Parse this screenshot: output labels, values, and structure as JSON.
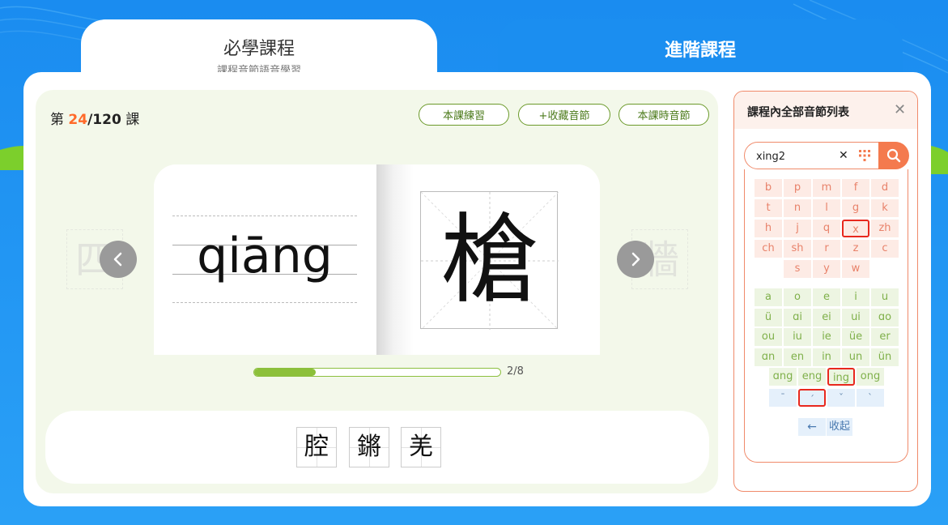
{
  "tabs": {
    "active": {
      "title": "必學課程",
      "subtitle": "課程音節語音學習"
    },
    "inactive": {
      "title": "進階課程"
    }
  },
  "lesson": {
    "prefix": "第 ",
    "current": "24",
    "separator": "/",
    "total": "120",
    "suffix": " 課",
    "buttons": {
      "practice": "本課練習",
      "favorite": "+收藏音節",
      "syllables": "本課時音節"
    }
  },
  "flashcard": {
    "pinyin": "qiāng",
    "character": "槍",
    "prev_ghost": "四",
    "next_ghost": "牆"
  },
  "progress": {
    "fraction": 0.25,
    "label": "2/8"
  },
  "related": [
    "腔",
    "鏘",
    "羌"
  ],
  "side_panel": {
    "title": "課程內全部音節列表",
    "search_value": "xing2",
    "initials": [
      [
        "b",
        "p",
        "m",
        "f",
        "d"
      ],
      [
        "t",
        "n",
        "l",
        "g",
        "k"
      ],
      [
        "h",
        "j",
        "q",
        "x",
        "zh"
      ],
      [
        "ch",
        "sh",
        "r",
        "z",
        "c"
      ],
      [
        "s",
        "y",
        "w"
      ]
    ],
    "finals": [
      [
        "a",
        "o",
        "e",
        "i",
        "u"
      ],
      [
        "ü",
        "ɑi",
        "ei",
        "ui",
        "ɑo"
      ],
      [
        "ou",
        "iu",
        "ie",
        "üe",
        "er"
      ],
      [
        "ɑn",
        "en",
        "in",
        "un",
        "ün"
      ],
      [
        "ɑng",
        "eng",
        "ing",
        "ong"
      ]
    ],
    "tones": [
      "ˉ",
      "ˊ",
      "ˇ",
      "ˋ"
    ],
    "selected_initial": "x",
    "selected_final": "ing",
    "selected_tone": "ˊ",
    "back_label": "←",
    "collapse_label": "收起"
  },
  "colors": {
    "accent": "#f47a4e",
    "lesson_bg": "#f3f8ea",
    "progress": "#8cc03a",
    "selection": "#e8281e"
  }
}
